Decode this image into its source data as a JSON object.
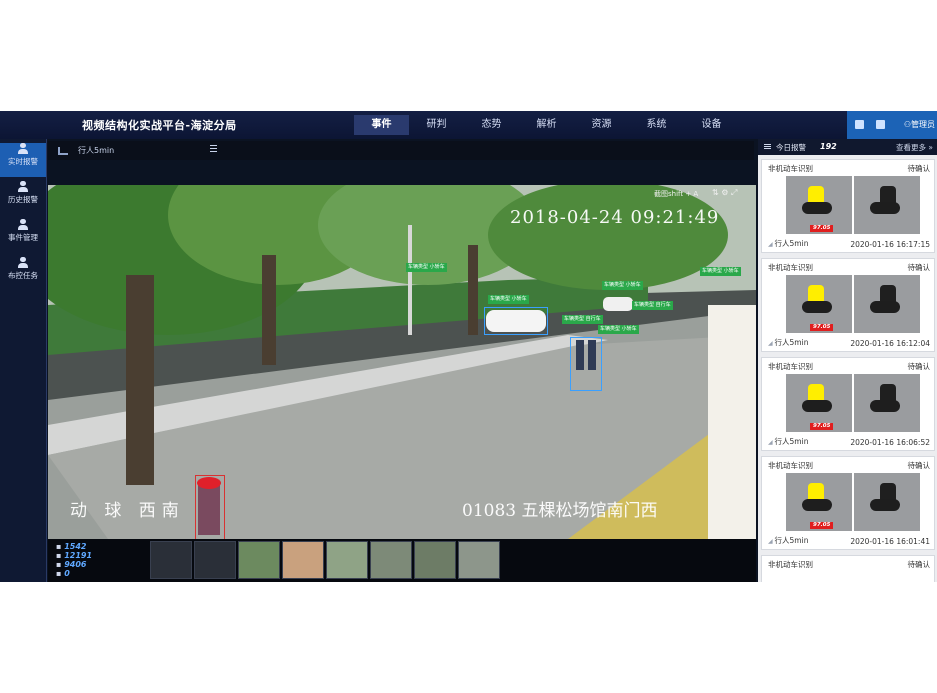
{
  "app": {
    "title": "视频结构化实战平台-海淀分局"
  },
  "nav": {
    "items": [
      "事件",
      "研判",
      "态势",
      "解析",
      "资源",
      "系统",
      "设备"
    ],
    "active": "事件"
  },
  "header_right": {
    "admin_label": "管理员"
  },
  "sidebar": {
    "items": [
      {
        "label": "实时报警",
        "icon": "alarm-person-icon",
        "active": true
      },
      {
        "label": "历史报警",
        "icon": "history-person-icon",
        "active": false
      },
      {
        "label": "事件管理",
        "icon": "event-manage-icon",
        "active": false
      },
      {
        "label": "布控任务",
        "icon": "deploy-task-icon",
        "active": false
      }
    ]
  },
  "control": {
    "label": "行人5min"
  },
  "video": {
    "timestamp": "2018-04-24  09:21:49",
    "snapshot_hint": "截图shift + A",
    "overlay_left": "动 球 西南",
    "overlay_right": "01083   五棵松场馆南门西",
    "detections": [
      "车辆类型 小轿车",
      "车辆类型 小轿车",
      "车辆类型 小轿车",
      "车辆类型 小轿车",
      "车辆类型 自行车",
      "车辆类型 自行车",
      "车辆类型 小轿车"
    ]
  },
  "bottom": {
    "counts": [
      "1542",
      "12191",
      "9406",
      "0"
    ]
  },
  "right_panel": {
    "title": "今日报警",
    "count": "192",
    "more_label": "查看更多 »",
    "cards": [
      {
        "type": "非机动车识别",
        "status": "待确认",
        "score": "97.05",
        "task": "行人5min",
        "time": "2020-01-16 16:17:15"
      },
      {
        "type": "非机动车识别",
        "status": "待确认",
        "score": "97.05",
        "task": "行人5min",
        "time": "2020-01-16 16:12:04"
      },
      {
        "type": "非机动车识别",
        "status": "待确认",
        "score": "97.05",
        "task": "行人5min",
        "time": "2020-01-16 16:06:52"
      },
      {
        "type": "非机动车识别",
        "status": "待确认",
        "score": "97.05",
        "task": "行人5min",
        "time": "2020-01-16 16:01:41"
      },
      {
        "type": "非机动车识别",
        "status": "待确认"
      }
    ]
  },
  "colors": {
    "accent": "#1d5fb3",
    "header": "#141f44",
    "detection": "#2aa84a",
    "alert": "#e01e1e"
  }
}
